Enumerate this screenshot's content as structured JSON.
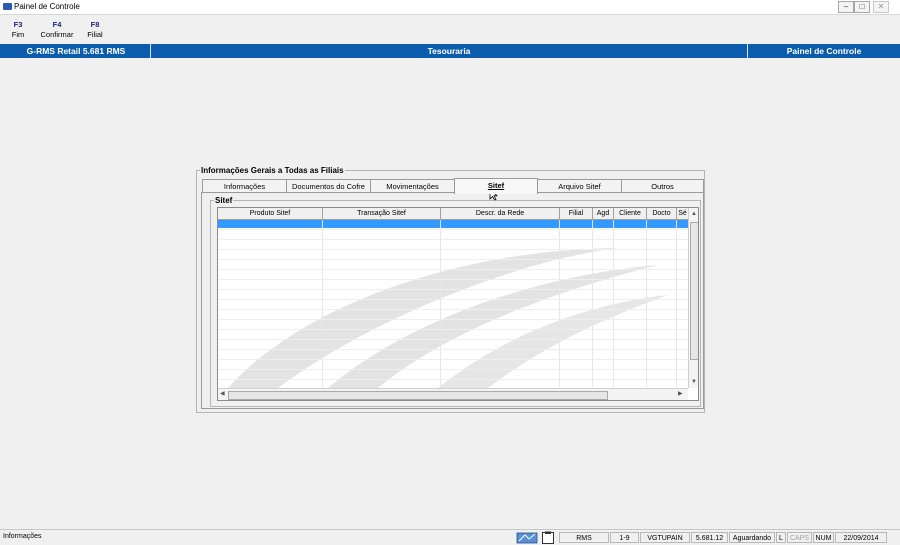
{
  "window": {
    "title": "Painel de Controle",
    "min": "–",
    "max": "□",
    "close": "✕"
  },
  "fkeys": [
    {
      "key": "F3",
      "label": "Fim"
    },
    {
      "key": "F4",
      "label": "Confirmar"
    },
    {
      "key": "F8",
      "label": "Filial"
    }
  ],
  "header": {
    "product": "G-RMS Retail 5.681 RMS",
    "module": "Tesouraria",
    "screen": "Painel de Controle"
  },
  "group": {
    "title": "Informações Gerais a Todas as Filiais"
  },
  "tabs": [
    {
      "label": "Informações"
    },
    {
      "label": "Documentos do Cofre"
    },
    {
      "label": "Movimentações"
    },
    {
      "label": "Sitef"
    },
    {
      "label": "Arquivo  Sitef"
    },
    {
      "label": "Outros"
    }
  ],
  "active_tab": "Sitef",
  "sitef": {
    "title": "Sitef",
    "columns": [
      "Produto Sitef",
      "Transação Sitef",
      "Descr. da Rede",
      "Filial",
      "Agd",
      "Cliente",
      "Docto",
      "Sé"
    ]
  },
  "statusbar": {
    "message": "Informações",
    "fields": [
      "RMS",
      "1-9",
      "VGTUPAIN",
      "5.681.12",
      "Aguardando",
      "L",
      "CAPS",
      "NUM",
      "22/09/2014"
    ]
  },
  "colors": {
    "header_bg": "#0b5cad",
    "selection": "#3399ff"
  }
}
